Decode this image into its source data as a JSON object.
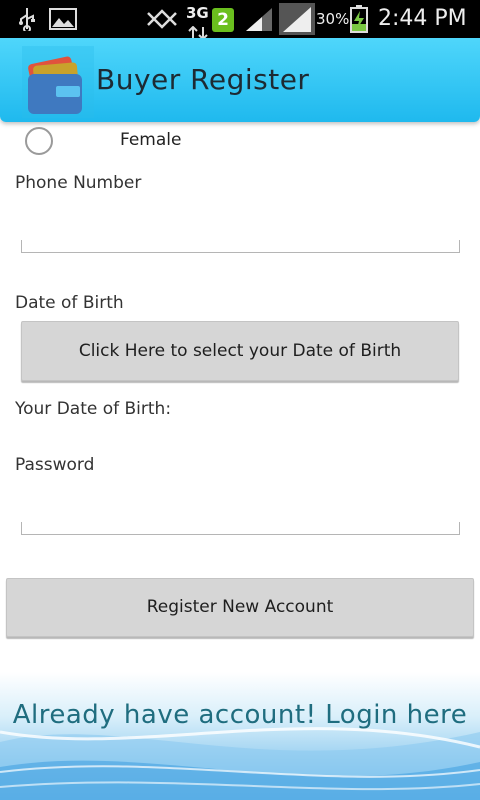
{
  "status_bar": {
    "network": "3G",
    "notification_count": "2",
    "battery_percent": "30%",
    "time": "2:44 PM",
    "icons": [
      "usb-icon",
      "image-icon",
      "mute-icon",
      "data-arrows-icon",
      "signal-icon",
      "signal-full-icon",
      "battery-charging-icon"
    ]
  },
  "action_bar": {
    "title": "Buyer Register",
    "icon": "wallet-card-icon",
    "accent_color": "#29c3f4"
  },
  "form": {
    "gender_option": "Female",
    "phone_label": "Phone Number",
    "phone_value": "",
    "dob_label": "Date of Birth",
    "dob_button": "Click Here to select your Date of Birth",
    "dob_display": "Your Date of Birth:",
    "password_label": "Password",
    "password_value": "",
    "register_button": "Register New Account"
  },
  "footer": {
    "login_link": "Already have account! Login here"
  }
}
